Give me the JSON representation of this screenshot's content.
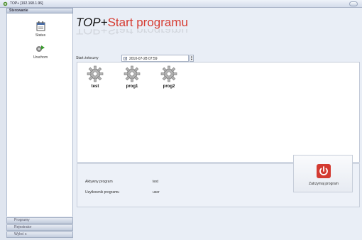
{
  "window": {
    "title": "TOP+ [192.168.1.96]"
  },
  "sidebar": {
    "section_label": "Sterowanie",
    "items": [
      {
        "label": "Status",
        "icon": "calendar-icon"
      },
      {
        "label": "Uruchom",
        "icon": "run-icon"
      }
    ],
    "bottom_tabs": [
      "Programy",
      "Rejestrator",
      "Wyloć s"
    ]
  },
  "header": {
    "brand": "TOP+",
    "subtitle": "Start programu"
  },
  "start": {
    "label": "Start żotoczny",
    "checkbox_checked": true,
    "datetime": "2010-07-28 07:59"
  },
  "programs": [
    {
      "name": "test"
    },
    {
      "name": "prog1"
    },
    {
      "name": "prog2"
    }
  ],
  "info": {
    "active_program_label": "Aktywny program",
    "active_program_value": "test",
    "user_label": "Uzytkownik programu",
    "user_value": "user"
  },
  "stop_button": {
    "label": "Zatrzymaj program"
  },
  "colors": {
    "accent_red": "#d63a30",
    "gear": "#b4b4b4"
  }
}
